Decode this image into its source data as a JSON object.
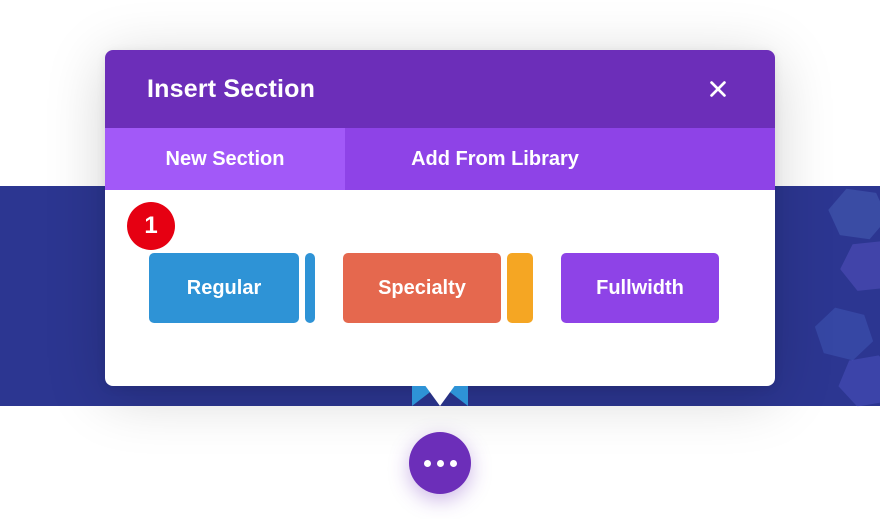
{
  "modal": {
    "title": "Insert Section",
    "tabs": {
      "new_section": "New Section",
      "add_from_library": "Add From Library"
    },
    "options": {
      "regular": "Regular",
      "specialty": "Specialty",
      "fullwidth": "Fullwidth"
    }
  },
  "annotation": {
    "badge_number": "1"
  },
  "icons": {
    "close": "close-icon",
    "more": "more-icon"
  },
  "colors": {
    "header": "#6c2eb9",
    "tabs_bg": "#8e43e7",
    "tab_active": "#a259f8",
    "regular": "#2e93d6",
    "specialty": "#e5684e",
    "specialty_stripe": "#f5a623",
    "fullwidth": "#8e43e7",
    "badge": "#e60012",
    "band": "#2c3691"
  }
}
